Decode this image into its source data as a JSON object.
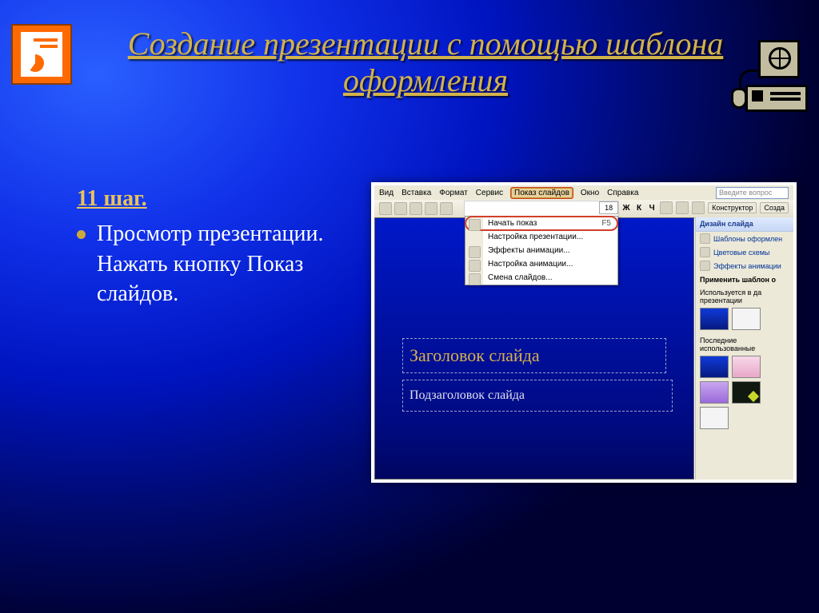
{
  "title": "Создание презентации с помощью шаблона оформления",
  "step_label": "11 шаг.",
  "bullet_text": "Просмотр презентации. Нажать кнопку Показ слайдов.",
  "screenshot": {
    "menubar": {
      "items": [
        "Вид",
        "Вставка",
        "Формат",
        "Сервис",
        "Показ слайдов",
        "Окно",
        "Справка"
      ],
      "active_index": 4,
      "ask_placeholder": "Введите вопрос"
    },
    "toolbar": {
      "font_size": "18",
      "bold": "Ж",
      "italic": "К",
      "underline": "Ч",
      "designer": "Конструктор",
      "create": "Созда"
    },
    "dropdown": [
      {
        "label": "Начать показ",
        "shortcut": "F5",
        "highlight": true
      },
      {
        "label": "Настройка презентации..."
      },
      {
        "label": "Эффекты анимации..."
      },
      {
        "label": "Настройка анимации..."
      },
      {
        "label": "Смена слайдов..."
      }
    ],
    "canvas": {
      "title_placeholder": "Заголовок слайда",
      "subtitle_placeholder": "Подзаголовок слайда"
    },
    "pane": {
      "header": "Дизайн слайда",
      "links": [
        "Шаблоны оформлен",
        "Цветовые схемы",
        "Эффекты анимации"
      ],
      "apply_label": "Применить шаблон о",
      "section_used": "Используется в да презентации",
      "section_recent": "Последние использованные"
    }
  }
}
